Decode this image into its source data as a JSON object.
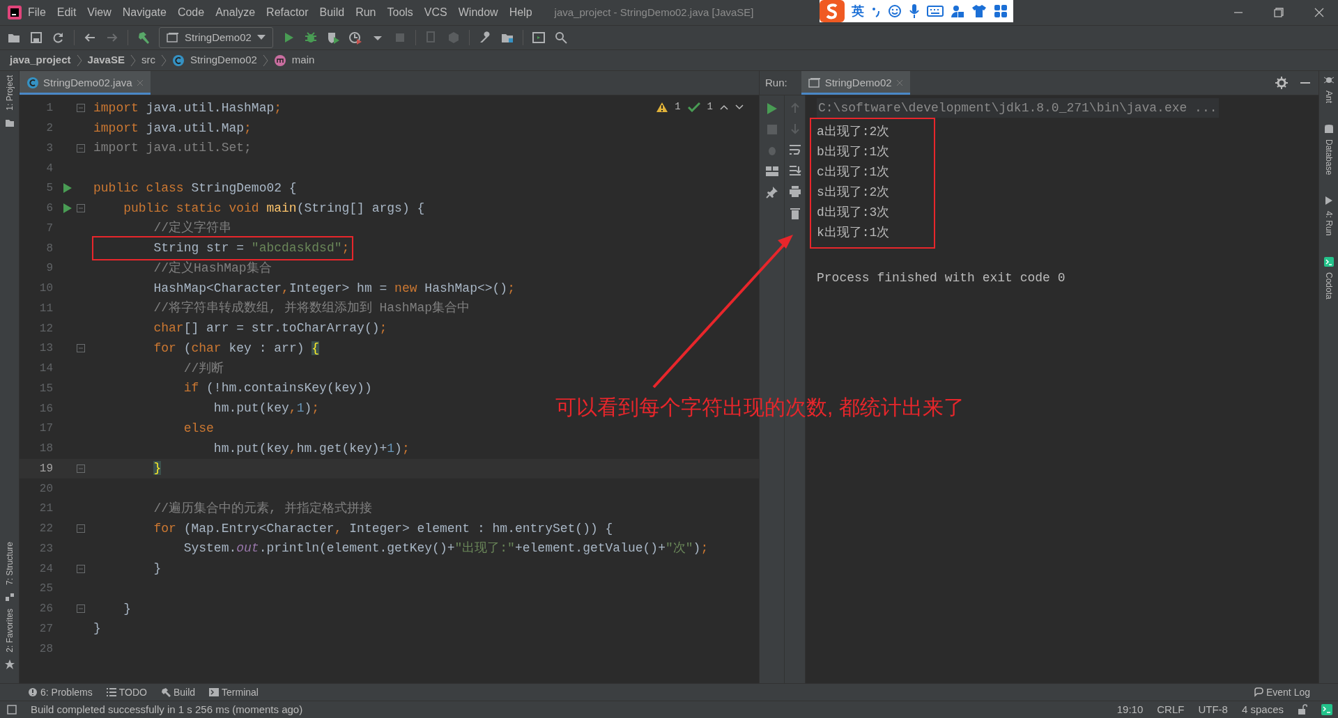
{
  "window": {
    "title": "java_project - StringDemo02.java [JavaSE]"
  },
  "menu": [
    "File",
    "Edit",
    "View",
    "Navigate",
    "Code",
    "Analyze",
    "Refactor",
    "Build",
    "Run",
    "Tools",
    "VCS",
    "Window",
    "Help"
  ],
  "ime_toolbar": {
    "label": "英"
  },
  "toolbar": {
    "run_config": "StringDemo02"
  },
  "breadcrumbs": [
    {
      "kind": "project",
      "label": "java_project"
    },
    {
      "kind": "project",
      "label": "JavaSE"
    },
    {
      "kind": "folder",
      "label": "src"
    },
    {
      "kind": "class",
      "label": "StringDemo02"
    },
    {
      "kind": "method",
      "label": "main"
    }
  ],
  "left_strip": [
    "1: Project",
    "7: Structure",
    "2: Favorites"
  ],
  "editor": {
    "tab": {
      "label": "StringDemo02.java",
      "selected": true
    },
    "inspections": {
      "warnings": "1",
      "passed": "1"
    },
    "lines": [
      {
        "number": "1",
        "fold": true,
        "run": false,
        "current": false,
        "boxed": false,
        "tokens": [
          {
            "kind": "keyword",
            "text": "import"
          },
          {
            "kind": "plain",
            "text": " java.util.HashMap"
          },
          {
            "kind": "keyword",
            "text": ";"
          }
        ]
      },
      {
        "number": "2",
        "fold": false,
        "run": false,
        "current": false,
        "boxed": false,
        "tokens": [
          {
            "kind": "keyword",
            "text": "import"
          },
          {
            "kind": "plain",
            "text": " java.util.Map"
          },
          {
            "kind": "keyword",
            "text": ";"
          }
        ]
      },
      {
        "number": "3",
        "fold": true,
        "run": false,
        "current": false,
        "boxed": false,
        "tokens": [
          {
            "kind": "unused",
            "text": "import java.util.Set;"
          }
        ]
      },
      {
        "number": "4",
        "fold": false,
        "run": false,
        "current": false,
        "boxed": false
      },
      {
        "number": "5",
        "fold": false,
        "run": true,
        "current": false,
        "boxed": false,
        "tokens": [
          {
            "kind": "keyword",
            "text": "public class"
          },
          {
            "kind": "plain",
            "text": " StringDemo02 {"
          }
        ]
      },
      {
        "number": "6",
        "fold": true,
        "run": true,
        "current": false,
        "boxed": false,
        "tokens": [
          {
            "kind": "keyword",
            "text": "    public static void "
          },
          {
            "kind": "method",
            "text": "main"
          },
          {
            "kind": "plain",
            "text": "(String[] args) {"
          }
        ]
      },
      {
        "number": "7",
        "fold": false,
        "run": false,
        "current": false,
        "boxed": false,
        "tokens": [
          {
            "kind": "comment",
            "text": "        //定义字符串"
          }
        ]
      },
      {
        "number": "8",
        "fold": false,
        "run": false,
        "current": false,
        "boxed": true,
        "tokens": [
          {
            "kind": "plain",
            "text": "        String str = "
          },
          {
            "kind": "string",
            "text": "\"abcdaskdsd\""
          },
          {
            "kind": "keyword",
            "text": ";"
          }
        ]
      },
      {
        "number": "9",
        "fold": false,
        "run": false,
        "current": false,
        "boxed": false,
        "tokens": [
          {
            "kind": "comment",
            "text": "        //定义HashMap集合"
          }
        ]
      },
      {
        "number": "10",
        "fold": false,
        "run": false,
        "current": false,
        "boxed": false,
        "tokens": [
          {
            "kind": "plain",
            "text": "        HashMap<Character"
          },
          {
            "kind": "keyword",
            "text": ","
          },
          {
            "kind": "plain",
            "text": "Integer> hm = "
          },
          {
            "kind": "keyword",
            "text": "new"
          },
          {
            "kind": "plain",
            "text": " HashMap<>()"
          },
          {
            "kind": "keyword",
            "text": ";"
          }
        ]
      },
      {
        "number": "11",
        "fold": false,
        "run": false,
        "current": false,
        "boxed": false,
        "tokens": [
          {
            "kind": "comment",
            "text": "        //将字符串转成数组, 并将数组添加到 HashMap集合中"
          }
        ]
      },
      {
        "number": "12",
        "fold": false,
        "run": false,
        "current": false,
        "boxed": false,
        "tokens": [
          {
            "kind": "keyword",
            "text": "        char"
          },
          {
            "kind": "plain",
            "text": "[] arr = str.toCharArray()"
          },
          {
            "kind": "keyword",
            "text": ";"
          }
        ]
      },
      {
        "number": "13",
        "fold": true,
        "run": false,
        "current": false,
        "boxed": false,
        "tokens": [
          {
            "kind": "keyword",
            "text": "        for"
          },
          {
            "kind": "plain",
            "text": " ("
          },
          {
            "kind": "keyword",
            "text": "char"
          },
          {
            "kind": "plain",
            "text": " key : arr) "
          },
          {
            "kind": "brace",
            "text": "{"
          }
        ]
      },
      {
        "number": "14",
        "fold": false,
        "run": false,
        "current": false,
        "boxed": false,
        "tokens": [
          {
            "kind": "comment",
            "text": "            //判断"
          }
        ]
      },
      {
        "number": "15",
        "fold": false,
        "run": false,
        "current": false,
        "boxed": false,
        "tokens": [
          {
            "kind": "keyword",
            "text": "            if"
          },
          {
            "kind": "plain",
            "text": " (!hm.containsKey(key))"
          }
        ]
      },
      {
        "number": "16",
        "fold": false,
        "run": false,
        "current": false,
        "boxed": false,
        "tokens": [
          {
            "kind": "plain",
            "text": "                hm.put(key"
          },
          {
            "kind": "keyword",
            "text": ","
          },
          {
            "kind": "number",
            "text": "1"
          },
          {
            "kind": "plain",
            "text": ")"
          },
          {
            "kind": "keyword",
            "text": ";"
          }
        ]
      },
      {
        "number": "17",
        "fold": false,
        "run": false,
        "current": false,
        "boxed": false,
        "tokens": [
          {
            "kind": "keyword",
            "text": "            else"
          }
        ]
      },
      {
        "number": "18",
        "fold": false,
        "run": false,
        "current": false,
        "boxed": false,
        "tokens": [
          {
            "kind": "plain",
            "text": "                hm.put(key"
          },
          {
            "kind": "keyword",
            "text": ","
          },
          {
            "kind": "plain",
            "text": "hm.get(key)+"
          },
          {
            "kind": "number",
            "text": "1"
          },
          {
            "kind": "plain",
            "text": ")"
          },
          {
            "kind": "keyword",
            "text": ";"
          }
        ]
      },
      {
        "number": "19",
        "fold": true,
        "run": false,
        "current": true,
        "boxed": false,
        "tokens": [
          {
            "kind": "brace",
            "text": "        }"
          }
        ]
      },
      {
        "number": "20",
        "fold": false,
        "run": false,
        "current": false,
        "boxed": false
      },
      {
        "number": "21",
        "fold": false,
        "run": false,
        "current": false,
        "boxed": false,
        "tokens": [
          {
            "kind": "comment",
            "text": "        //遍历集合中的元素, 并指定格式拼接"
          }
        ]
      },
      {
        "number": "22",
        "fold": true,
        "run": false,
        "current": false,
        "boxed": false,
        "tokens": [
          {
            "kind": "keyword",
            "text": "        for"
          },
          {
            "kind": "plain",
            "text": " (Map.Entry<Character"
          },
          {
            "kind": "keyword",
            "text": ","
          },
          {
            "kind": "plain",
            "text": " Integer> element : hm.entrySet()) {"
          }
        ]
      },
      {
        "number": "23",
        "fold": false,
        "run": false,
        "current": false,
        "boxed": false,
        "tokens": [
          {
            "kind": "plain",
            "text": "            System."
          },
          {
            "kind": "field",
            "text": "out"
          },
          {
            "kind": "plain",
            "text": ".println(element.getKey()+"
          },
          {
            "kind": "string",
            "text": "\"出现了:\""
          },
          {
            "kind": "plain",
            "text": "+element.getValue()+"
          },
          {
            "kind": "string",
            "text": "\"次\""
          },
          {
            "kind": "plain",
            "text": ")"
          },
          {
            "kind": "keyword",
            "text": ";"
          }
        ]
      },
      {
        "number": "24",
        "fold": true,
        "run": false,
        "current": false,
        "boxed": false,
        "tokens": [
          {
            "kind": "plain",
            "text": "        }"
          }
        ]
      },
      {
        "number": "25",
        "fold": false,
        "run": false,
        "current": false,
        "boxed": false
      },
      {
        "number": "26",
        "fold": true,
        "run": false,
        "current": false,
        "boxed": false,
        "tokens": [
          {
            "kind": "plain",
            "text": "    }"
          }
        ]
      },
      {
        "number": "27",
        "fold": false,
        "run": false,
        "current": false,
        "boxed": false,
        "tokens": [
          {
            "kind": "plain",
            "text": "}"
          }
        ]
      },
      {
        "number": "28",
        "fold": false,
        "run": false,
        "current": false,
        "boxed": false
      }
    ]
  },
  "run_panel": {
    "label": "Run:",
    "tab": {
      "label": "StringDemo02",
      "selected": true
    },
    "command": "C:\\software\\development\\jdk1.8.0_271\\bin\\java.exe ...",
    "output_boxed": true,
    "output": [
      "a出现了:2次",
      "b出现了:1次",
      "c出现了:1次",
      "s出现了:2次",
      "d出现了:3次",
      "k出现了:1次"
    ],
    "exit_message": "Process finished with exit code 0"
  },
  "right_strip": [
    "Ant",
    "Database",
    "4: Run",
    "Codota"
  ],
  "annotation": {
    "text": "可以看到每个字符出现的次数, 都统计出来了"
  },
  "tool_tabs": [
    "6: Problems",
    "TODO",
    "Build",
    "Terminal"
  ],
  "event_log": "Event Log",
  "status_bar": {
    "message": "Build completed successfully in 1 s 256 ms (moments ago)",
    "items": [
      "19:10",
      "CRLF",
      "UTF-8",
      "4 spaces"
    ]
  }
}
